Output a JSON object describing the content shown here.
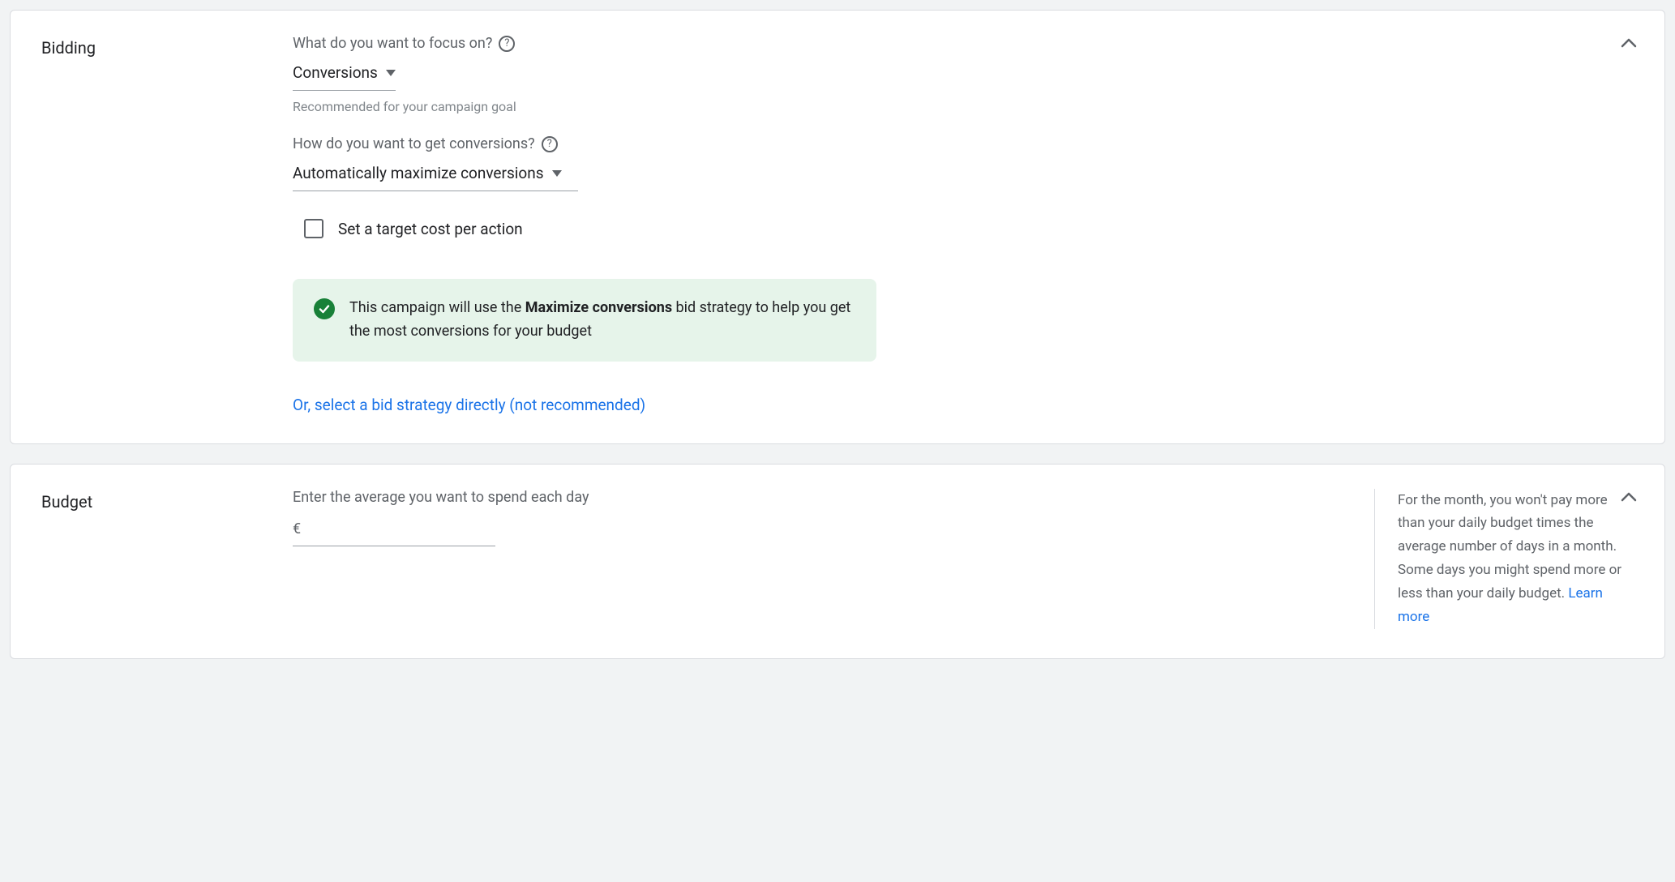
{
  "bidding": {
    "section_title": "Bidding",
    "focus_label": "What do you want to focus on?",
    "focus_value": "Conversions",
    "focus_hint": "Recommended for your campaign goal",
    "how_label": "How do you want to get conversions?",
    "how_value": "Automatically maximize conversions",
    "checkbox_label": "Set a target cost per action",
    "banner_pre": "This campaign will use the ",
    "banner_bold": "Maximize conversions",
    "banner_post": " bid strategy to help you get the most conversions for your budget",
    "direct_link": "Or, select a bid strategy directly (not recommended)"
  },
  "budget": {
    "section_title": "Budget",
    "label": "Enter the average you want to spend each day",
    "currency_symbol": "€",
    "side_text": "For the month, you won't pay more than your daily budget times the average number of days in a month. Some days you might spend more or less than your daily budget. ",
    "learn_more": "Learn more"
  }
}
